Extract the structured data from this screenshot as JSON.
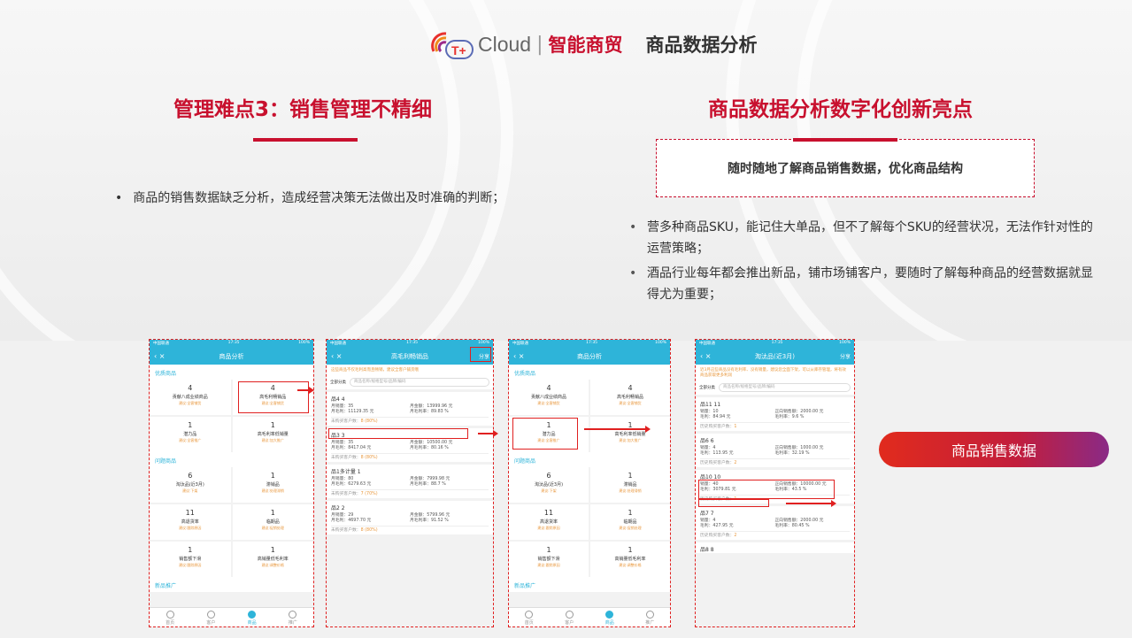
{
  "header": {
    "logo_text": "Cloud",
    "logo_separator": "|",
    "brand": "智能商贸",
    "page_title": "商品数据分析"
  },
  "left": {
    "title": "管理难点3：销售管理不精细",
    "bullet": "商品的销售数据缺乏分析，造成经营决策无法做出及时准确的判断；"
  },
  "right": {
    "title": "商品数据分析数字化创新亮点",
    "box_text": "随时随地了解商品销售数据，优化商品结构",
    "bullets": [
      "营多种商品SKU，能记住大单品，但不了解每个SKU的经营状况，无法作针对性的运营策略；",
      "酒品行业每年都会推出新品，铺市场铺客户，要随时了解每种商品的经营数据就显得尤为重要；"
    ]
  },
  "cta": {
    "label": "商品销售数据"
  },
  "phone1": {
    "status_carrier": "中国联通",
    "status_time": "17:35",
    "status_battery": "100%",
    "nav_back": "‹  ×",
    "title": "商品分析",
    "sec1": "优质商品",
    "sec1_cells": [
      {
        "n": "4",
        "l": "贡献八成业绩商品",
        "s": "建议:全客铺货"
      },
      {
        "n": "4",
        "l": "高毛利畅销品",
        "s": "建议:全客铺货"
      },
      {
        "n": "1",
        "l": "潜力品",
        "s": "建议:全客推广"
      },
      {
        "n": "1",
        "l": "高毛利率低销量",
        "s": "建议:加大推广"
      }
    ],
    "sec2": "问题商品",
    "sec2_cells": [
      {
        "n": "6",
        "l": "淘汰品(近3月)",
        "s": "建议:下架"
      },
      {
        "n": "1",
        "l": "滞销品",
        "s": "建议:处理滞销"
      },
      {
        "n": "11",
        "l": "高退货率",
        "s": "建议:跟踪原因"
      },
      {
        "n": "1",
        "l": "临期品",
        "s": "建议:促销处理"
      },
      {
        "n": "1",
        "l": "销售额下滑",
        "s": "建议:跟踪原因"
      },
      {
        "n": "1",
        "l": "高销量低毛利率",
        "s": "建议:调整价格"
      }
    ],
    "sec3": "新品推广",
    "tabs": [
      "首页",
      "客户",
      "商品",
      "推广"
    ]
  },
  "phone2": {
    "status_carrier": "中国联通",
    "status_time": "17:35",
    "status_battery": "100%",
    "nav_back": "‹  ×",
    "title": "高毛利畅销品",
    "share": "分享",
    "tip": "这些商品不仅毛利高而且畅销，建议全客户铺货哦",
    "filter_cat": "全部分类",
    "filter_placeholder": "商品名称/规格型号/品牌/编码",
    "items": [
      {
        "t": "品4  4",
        "r1a": "月销量：35",
        "r1b": "月金额：13999.96 元",
        "r2a": "月毛利：11129.35 元",
        "r2b": "月毛利率：89.83 %",
        "foot": "未购买客户数：",
        "fv": "8 (80%)"
      },
      {
        "t": "品3  3",
        "r1a": "月销量：35",
        "r1b": "月金额：10500.00 元",
        "r2a": "月毛利：8417.04 元",
        "r2b": "月毛利率：80.16 %",
        "foot": "未购买客户数：",
        "fv": "8 (80%)"
      },
      {
        "t": "品1多计量  1",
        "r1a": "月销量：80",
        "r1b": "月金额：7999.98 元",
        "r2a": "月毛利：6279.63 元",
        "r2b": "月毛利率：88.7 %",
        "foot": "未购买客户数：",
        "fv": "7 (70%)"
      },
      {
        "t": "品2  2",
        "r1a": "月销量：29",
        "r1b": "月金额：5799.96 元",
        "r2a": "月毛利：4697.70 元",
        "r2b": "月毛利率：91.52 %",
        "foot": "未购买客户数：",
        "fv": "8 (80%)"
      }
    ]
  },
  "phone3": {
    "status_carrier": "中国联通",
    "status_time": "17:35",
    "status_battery": "100%",
    "nav_back": "‹  ×",
    "title": "商品分析",
    "sec1": "优质商品",
    "sec1_cells": [
      {
        "n": "4",
        "l": "贡献八成业绩商品",
        "s": "建议:全客铺货"
      },
      {
        "n": "4",
        "l": "高毛利畅销品",
        "s": "建议:全客铺货"
      },
      {
        "n": "1",
        "l": "潜力品",
        "s": "建议:全客推广"
      },
      {
        "n": "1",
        "l": "高毛利率低销量",
        "s": "建议:加大推广"
      }
    ],
    "sec2": "问题商品",
    "sec2_cells": [
      {
        "n": "6",
        "l": "淘汰品(近3月)",
        "s": "建议:下架"
      },
      {
        "n": "1",
        "l": "滞销品",
        "s": "建议:处理滞销"
      },
      {
        "n": "11",
        "l": "高退货率",
        "s": "建议:跟踪原因"
      },
      {
        "n": "1",
        "l": "临期品",
        "s": "建议:促销处理"
      },
      {
        "n": "1",
        "l": "销售额下滑",
        "s": "建议:跟踪原因"
      },
      {
        "n": "1",
        "l": "高销量低毛利率",
        "s": "建议:调整价格"
      }
    ],
    "sec3": "新品推广",
    "tabs": [
      "首页",
      "客户",
      "商品",
      "推广"
    ]
  },
  "phone4": {
    "status_carrier": "中国联通",
    "status_time": "17:35",
    "status_battery": "100%",
    "nav_back": "‹  ×",
    "title": "淘汰品(近3月)",
    "share": "分享",
    "tip": "近3月这些商品没有毛利率、没有销量，建议您全面下架，可以从库存管理，将有效商品获取更多利润",
    "filter_cat": "全部分类",
    "filter_placeholder": "商品名称/规格型号/品牌/编码",
    "items": [
      {
        "t": "品11  11",
        "r1a": "销量：10",
        "r1b": "正向销售额：2000.00 元",
        "r2a": "毛利：84.94 元",
        "r2b": "毛利率：9.6 %",
        "foot": "历史购买客户数：",
        "fv": "1"
      },
      {
        "t": "品6  6",
        "r1a": "销量：4",
        "r1b": "正向销售额：1000.00 元",
        "r2a": "毛利：113.95 元",
        "r2b": "毛利率：32.19 %",
        "foot": "历史购买客户数：",
        "fv": "2"
      },
      {
        "t": "品10  10",
        "r1a": "销量：40",
        "r1b": "正向销售额：10000.00 元",
        "r2a": "毛利：3079.81 元",
        "r2b": "毛利率：43.5 %",
        "foot": "历史购买客户数：",
        "fv": "1"
      },
      {
        "t": "品7  7",
        "r1a": "销量：4",
        "r1b": "正向销售额：2000.00 元",
        "r2a": "毛利：427.95 元",
        "r2b": "毛利率：80.45 %",
        "foot": "历史购买客户数：",
        "fv": "2"
      }
    ],
    "last_item": "品8  8"
  }
}
